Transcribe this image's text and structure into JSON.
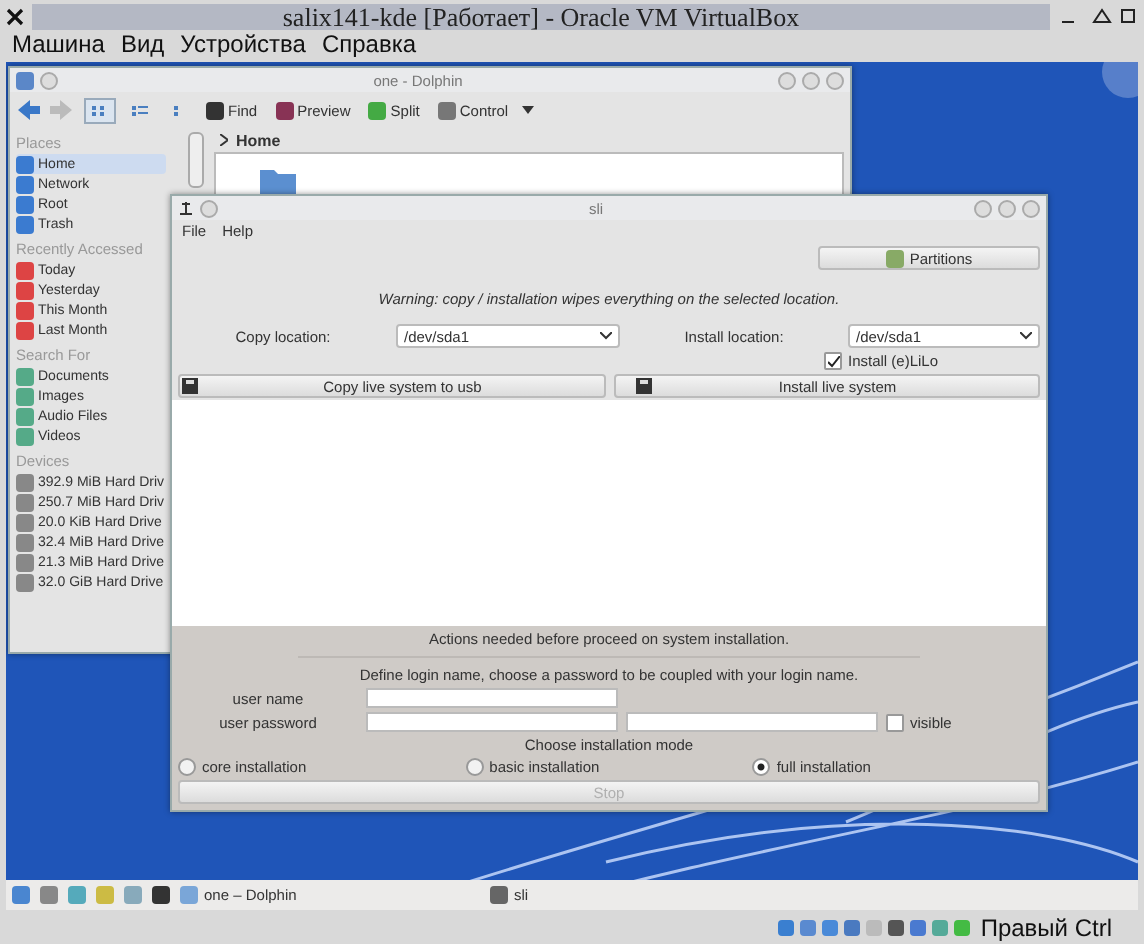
{
  "vbox": {
    "title": "salix141-kde [Работает] - Oracle VM VirtualBox",
    "menu": [
      "Машина",
      "Вид",
      "Устройства",
      "Справка"
    ],
    "host_key": "Правый Ctrl"
  },
  "dolphin": {
    "title": "one - Dolphin",
    "toolbar": [
      {
        "kind": "find",
        "label": "Find"
      },
      {
        "kind": "preview",
        "label": "Preview"
      },
      {
        "kind": "split",
        "label": "Split"
      },
      {
        "kind": "control",
        "label": "Control"
      }
    ],
    "breadcrumb": "Home",
    "sidebar": [
      {
        "kind": "places",
        "heading": "Places",
        "items": [
          {
            "label": "Home",
            "selected": true
          },
          {
            "label": "Network",
            "selected": false
          },
          {
            "label": "Root",
            "selected": false
          },
          {
            "label": "Trash",
            "selected": false
          }
        ]
      },
      {
        "kind": "recent",
        "heading": "Recently Accessed",
        "items": [
          {
            "label": "Today",
            "selected": false
          },
          {
            "label": "Yesterday",
            "selected": false
          },
          {
            "label": "This Month",
            "selected": false
          },
          {
            "label": "Last Month",
            "selected": false
          }
        ]
      },
      {
        "kind": "search",
        "heading": "Search For",
        "items": [
          {
            "label": "Documents",
            "selected": false
          },
          {
            "label": "Images",
            "selected": false
          },
          {
            "label": "Audio Files",
            "selected": false
          },
          {
            "label": "Videos",
            "selected": false
          }
        ]
      },
      {
        "kind": "devices",
        "heading": "Devices",
        "items": [
          {
            "label": "392.9 MiB Hard Driv",
            "selected": false
          },
          {
            "label": "250.7 MiB Hard Driv",
            "selected": false
          },
          {
            "label": "20.0 KiB Hard Drive",
            "selected": false
          },
          {
            "label": "32.4 MiB Hard Drive",
            "selected": false
          },
          {
            "label": "21.3 MiB Hard Drive",
            "selected": false
          },
          {
            "label": "32.0 GiB Hard Drive",
            "selected": false
          }
        ]
      }
    ]
  },
  "sli": {
    "title": "sli",
    "menu": [
      "File",
      "Help"
    ],
    "partitions_button": "Partitions",
    "warning": "Warning: copy / installation wipes everything on the selected location.",
    "copy_location": {
      "label": "Copy location:",
      "value": "/dev/sda1"
    },
    "install_location": {
      "label": "Install location:",
      "value": "/dev/sda1"
    },
    "install_elilo": {
      "label": "Install (e)LiLo",
      "checked": true
    },
    "actions": [
      "Copy live system to usb",
      "Install live system"
    ],
    "status": "Actions needed before proceed on system installation.",
    "login_hint": "Define login name, choose a password to be coupled with your login name.",
    "user_name_label": "user name",
    "user_password_label": "user password",
    "visible": {
      "label": "visible",
      "checked": false
    },
    "mode_heading": "Choose installation mode",
    "modes": [
      {
        "label": "core installation",
        "selected": false
      },
      {
        "label": "basic installation",
        "selected": false
      },
      {
        "label": "full installation",
        "selected": true
      }
    ],
    "stop": {
      "label": "Stop",
      "disabled": true
    }
  },
  "taskbar": {
    "tasks": [
      {
        "label": "one – Dolphin"
      },
      {
        "label": "sli"
      }
    ]
  }
}
